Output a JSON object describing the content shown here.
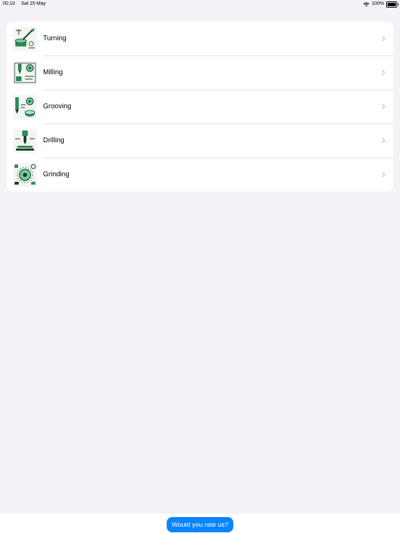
{
  "status_bar": {
    "time": "00:10",
    "date": "Sat 25 May",
    "battery": "100%",
    "battery_level": 1.0
  },
  "menu": {
    "items": [
      {
        "label": "Turning",
        "icon": "turning-illustration-icon"
      },
      {
        "label": "Milling",
        "icon": "milling-illustration-icon"
      },
      {
        "label": "Grooving",
        "icon": "grooving-illustration-icon"
      },
      {
        "label": "Drilling",
        "icon": "drilling-illustration-icon"
      },
      {
        "label": "Grinding",
        "icon": "grinding-illustration-icon"
      }
    ]
  },
  "footer": {
    "rate_label": "Would you rate us?"
  },
  "colors": {
    "background": "#f2f2f7",
    "accent": "#0a84ff",
    "illustration_green": "#2e8b57",
    "illustration_dark": "#1c3b2a"
  }
}
